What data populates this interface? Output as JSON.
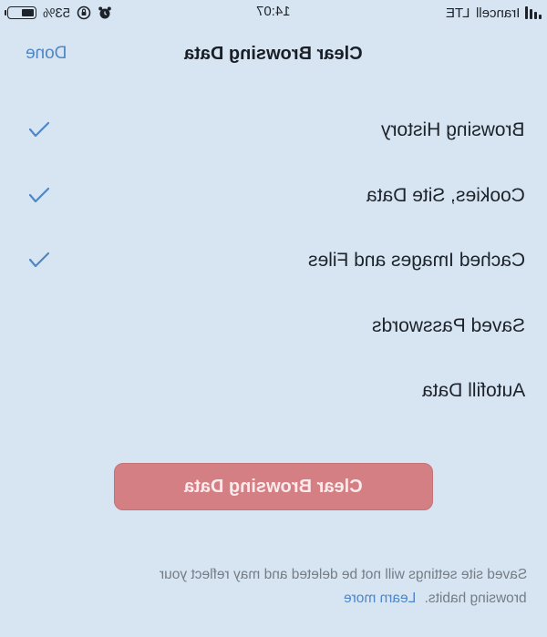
{
  "status_bar": {
    "carrier": "Irancell",
    "network": "LTE",
    "time": "14:07",
    "battery_percent": "53%",
    "battery_level": 0.53,
    "icons": [
      "signal-bars-icon",
      "alarm-clock-icon",
      "orientation-lock-icon",
      "battery-icon"
    ]
  },
  "header": {
    "title": "Clear Browsing Data",
    "done_label": "Done"
  },
  "options": [
    {
      "label": "Browsing History",
      "checked": true
    },
    {
      "label": "Cookies, Site Data",
      "checked": true
    },
    {
      "label": "Cached Images and Files",
      "checked": true
    },
    {
      "label": "Saved Passwords",
      "checked": false
    },
    {
      "label": "Autofill Data",
      "checked": false
    }
  ],
  "clear_button": {
    "label": "Clear Browsing Data"
  },
  "footer": {
    "line1": "Saved site settings will not be deleted and may reflect your",
    "line2": "browsing habits.",
    "learn_more": "Learn more"
  },
  "colors": {
    "background": "#d6e5f1",
    "accent": "#4f86c6",
    "destructive": "#d47f84",
    "text": "#1e232b",
    "secondary_text": "#757d86"
  }
}
